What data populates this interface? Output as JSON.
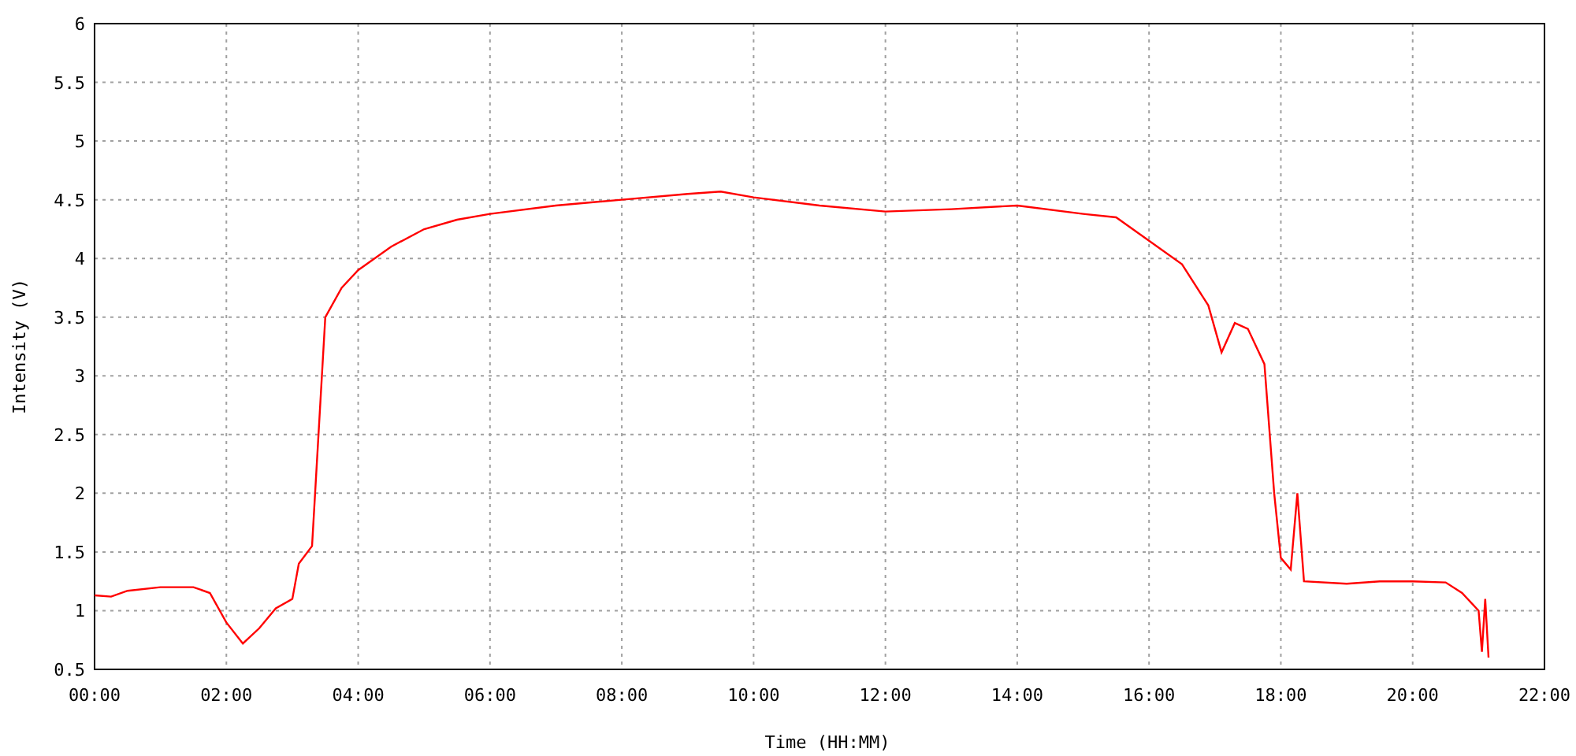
{
  "chart_data": {
    "type": "line",
    "grid": true,
    "xlabel": "Time (HH:MM)",
    "ylabel": "Intensity (V)",
    "x": [
      0,
      0.25,
      0.5,
      1,
      1.5,
      1.75,
      2,
      2.25,
      2.5,
      2.75,
      3,
      3.1,
      3.3,
      3.5,
      3.75,
      4,
      4.5,
      5,
      5.5,
      6,
      7,
      8,
      9,
      9.5,
      10,
      11,
      12,
      13,
      14,
      15,
      15.5,
      16,
      16.5,
      16.9,
      17.1,
      17.3,
      17.5,
      17.75,
      17.9,
      18,
      18.15,
      18.25,
      18.35,
      19,
      19.5,
      20,
      20.5,
      20.75,
      21,
      21.05,
      21.1,
      21.15
    ],
    "series": [
      {
        "color": "#ff0000",
        "values": [
          1.13,
          1.12,
          1.17,
          1.2,
          1.2,
          1.15,
          0.9,
          0.72,
          0.85,
          1.02,
          1.1,
          1.4,
          1.55,
          3.5,
          3.75,
          3.9,
          4.1,
          4.25,
          4.33,
          4.38,
          4.45,
          4.5,
          4.55,
          4.57,
          4.52,
          4.45,
          4.4,
          4.42,
          4.45,
          4.38,
          4.35,
          4.15,
          3.95,
          3.6,
          3.2,
          3.45,
          3.4,
          3.1,
          2.0,
          1.45,
          1.35,
          2.0,
          1.25,
          1.23,
          1.25,
          1.25,
          1.24,
          1.15,
          1.0,
          0.65,
          1.1,
          0.6
        ]
      }
    ],
    "xlim": [
      0,
      22
    ],
    "ylim": [
      0.5,
      6
    ],
    "xticks": [
      {
        "value": 0,
        "label": "00:00"
      },
      {
        "value": 2,
        "label": "02:00"
      },
      {
        "value": 4,
        "label": "04:00"
      },
      {
        "value": 6,
        "label": "06:00"
      },
      {
        "value": 8,
        "label": "08:00"
      },
      {
        "value": 10,
        "label": "10:00"
      },
      {
        "value": 12,
        "label": "12:00"
      },
      {
        "value": 14,
        "label": "14:00"
      },
      {
        "value": 16,
        "label": "16:00"
      },
      {
        "value": 18,
        "label": "18:00"
      },
      {
        "value": 20,
        "label": "20:00"
      },
      {
        "value": 22,
        "label": "22:00"
      }
    ],
    "yticks": [
      0.5,
      1,
      1.5,
      2,
      2.5,
      3,
      3.5,
      4,
      4.5,
      5,
      5.5,
      6
    ]
  }
}
